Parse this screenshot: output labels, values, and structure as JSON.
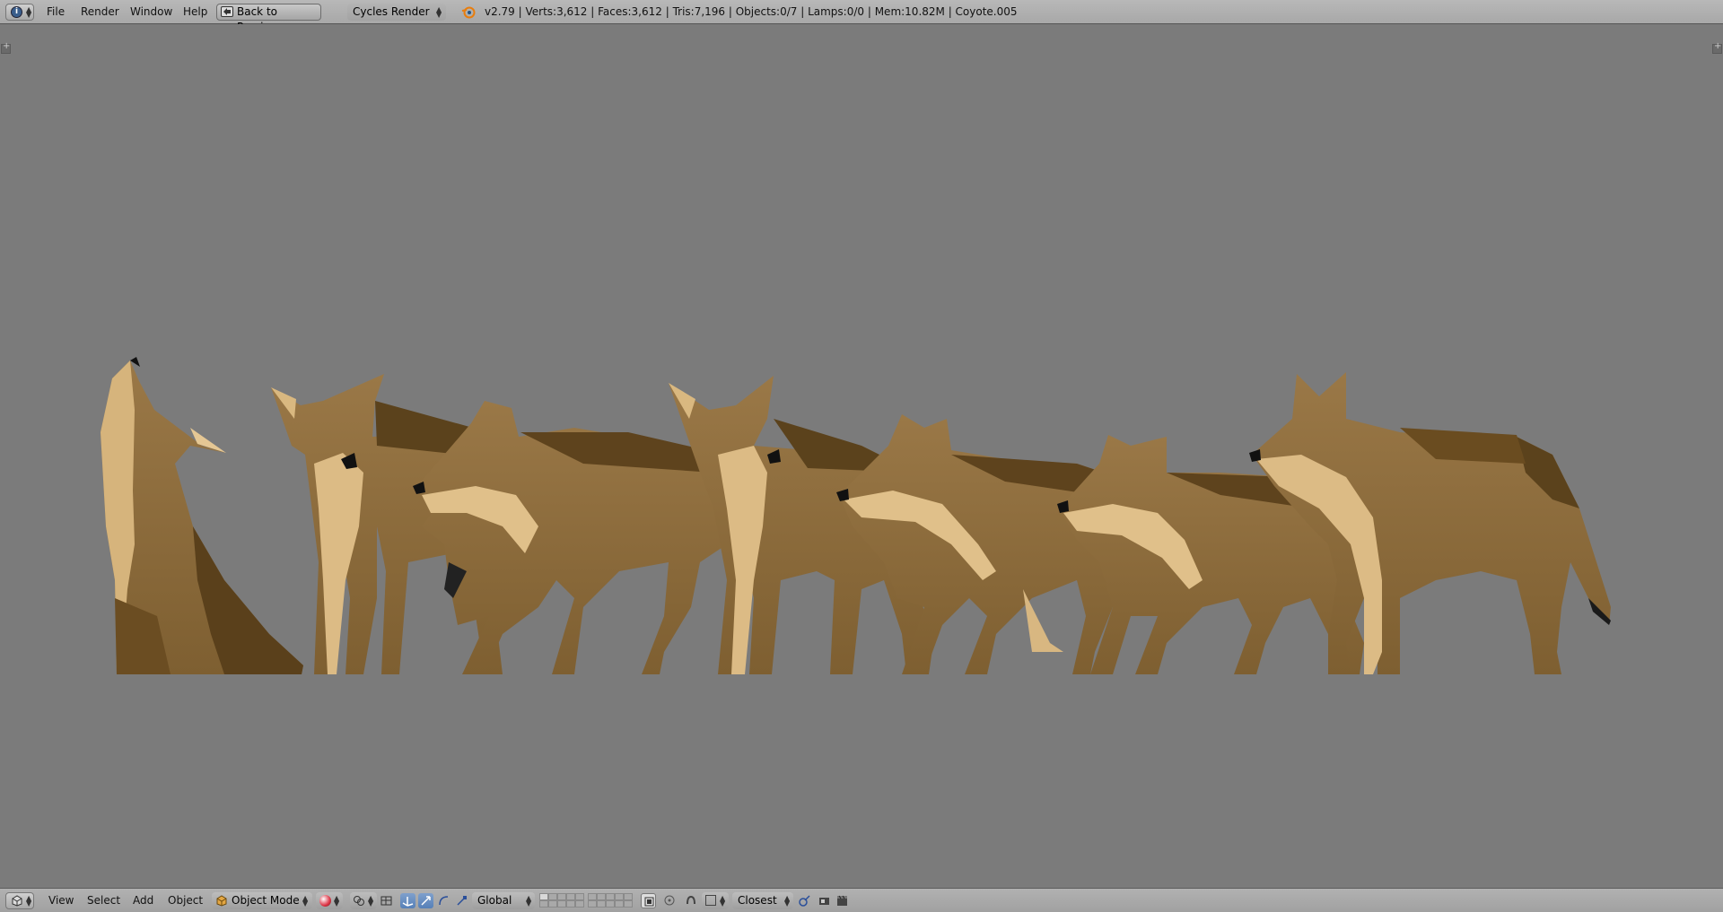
{
  "topbar": {
    "menus": [
      "File",
      "Render",
      "Window",
      "Help"
    ],
    "back_label": "Back to Previous",
    "render_engine": "Cycles Render",
    "stats": "v2.79 | Verts:3,612 | Faces:3,612 | Tris:7,196 | Objects:0/7 | Lamps:0/0 | Mem:10.82M | Coyote.005"
  },
  "bottombar": {
    "menus": [
      "View",
      "Select",
      "Add",
      "Object"
    ],
    "mode": "Object Mode",
    "orientation": "Global",
    "snap_target": "Closest"
  },
  "icons": {
    "editor_type": "info-icon",
    "back": "back-arrow-icon",
    "blender": "blender-logo-icon",
    "viewport_editor": "3d-view-icon",
    "mode": "cube-icon",
    "shading": "sphere-shading-icon",
    "pivot": "pivot-icon",
    "manipulator": "manipulator-icon",
    "translate": "translate-icon",
    "rotate": "rotate-icon",
    "scale": "scale-icon",
    "render_view": "render-icon",
    "anim_render": "clapper-icon"
  },
  "colors": {
    "viewport_bg": "#7b7b7b",
    "coyote_base": "#8d6e3f",
    "coyote_light": "#d8b77f",
    "coyote_dark": "#4e3716"
  }
}
